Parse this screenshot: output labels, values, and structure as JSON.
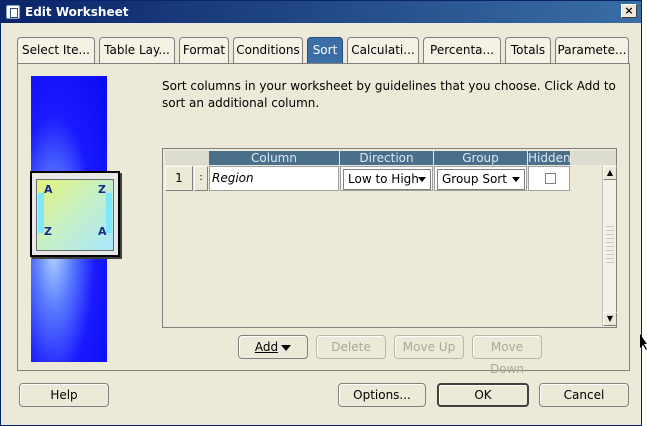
{
  "window": {
    "title": "Edit Worksheet",
    "close_glyph": "×"
  },
  "tabs": [
    {
      "label": "Select Ite...",
      "active": false
    },
    {
      "label": "Table Lay...",
      "active": false
    },
    {
      "label": "Format",
      "active": false
    },
    {
      "label": "Conditions",
      "active": false
    },
    {
      "label": "Sort",
      "active": true
    },
    {
      "label": "Calculati...",
      "active": false
    },
    {
      "label": "Percenta...",
      "active": false
    },
    {
      "label": "Totals",
      "active": false
    },
    {
      "label": "Paramete...",
      "active": false
    }
  ],
  "sort_panel": {
    "instructions": "Sort columns in your worksheet by guidelines that you choose.  Click Add to sort an additional column.",
    "icon_letters": {
      "a_top": "A",
      "z_top": "Z",
      "z_bottom": "Z",
      "a_bottom": "A"
    },
    "grid": {
      "headers": {
        "column": "Column",
        "direction": "Direction",
        "group": "Group",
        "hidden": "Hidden"
      },
      "rows": [
        {
          "num": "1",
          "handle": ":",
          "column": "Region",
          "direction": "Low to High",
          "group": "Group Sort",
          "hidden": false
        }
      ],
      "scroll_up": "▲",
      "scroll_down": "▼"
    },
    "buttons": {
      "add": "Add",
      "delete": "Delete",
      "move_up": "Move Up",
      "move_down": "Move Down"
    }
  },
  "footer": {
    "help": "Help",
    "options": "Options...",
    "ok": "OK",
    "cancel": "Cancel"
  },
  "colors": {
    "active_tab": "#3a6ea5",
    "header": "#4a6f8a",
    "dialog_bg": "#ece9d8"
  }
}
